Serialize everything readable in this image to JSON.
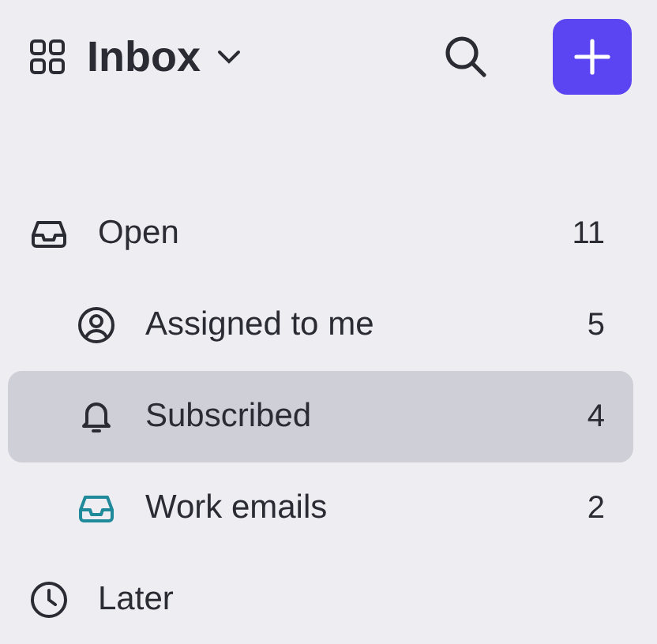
{
  "header": {
    "title": "Inbox"
  },
  "items": [
    {
      "kind": "inbox",
      "label": "Open",
      "count": "11",
      "selected": false,
      "color": "#2b2b33",
      "children": [
        {
          "kind": "user",
          "label": "Assigned to me",
          "count": "5",
          "selected": false,
          "color": "#2b2b33"
        },
        {
          "kind": "bell",
          "label": "Subscribed",
          "count": "4",
          "selected": true,
          "color": "#2b2b33"
        },
        {
          "kind": "inbox",
          "label": "Work emails",
          "count": "2",
          "selected": false,
          "color": "#1f8a99"
        }
      ]
    },
    {
      "kind": "clock",
      "label": "Later",
      "selected": false,
      "color": "#2b2b33"
    }
  ]
}
